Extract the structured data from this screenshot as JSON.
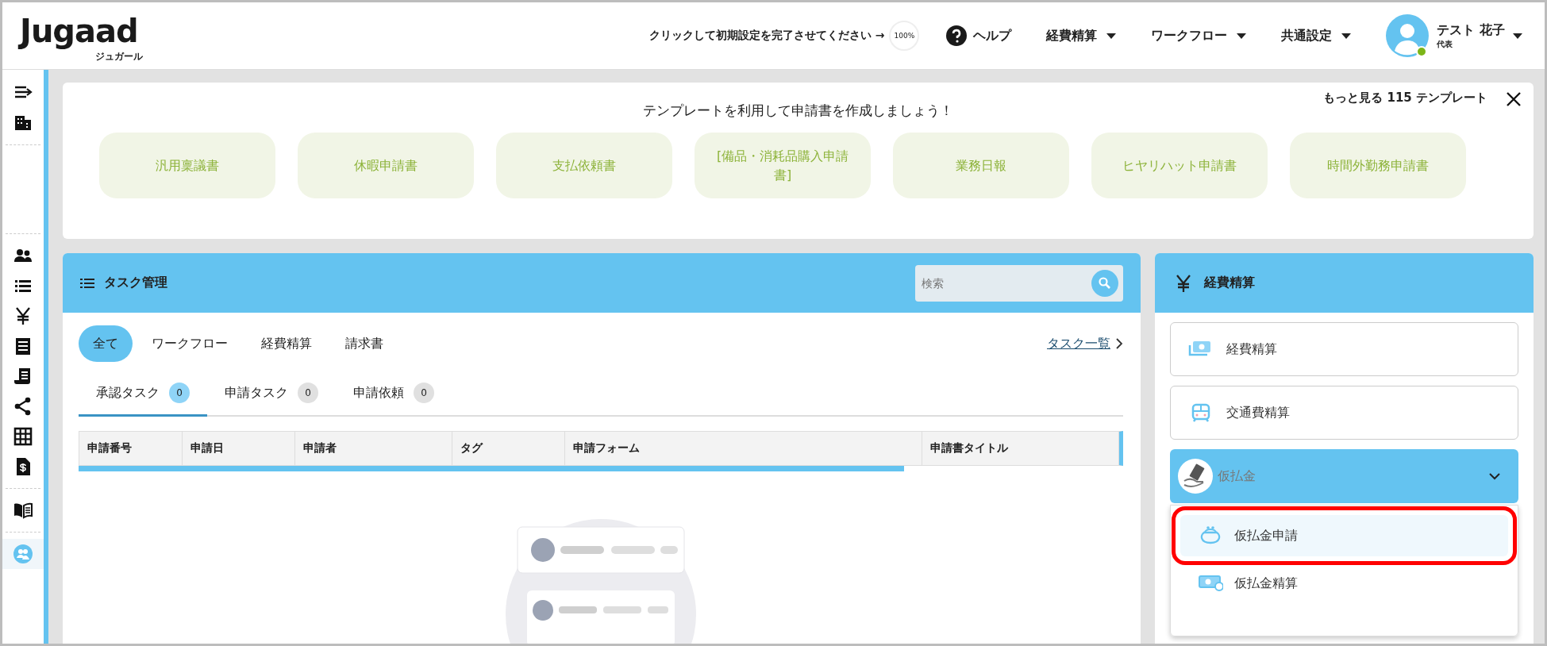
{
  "header": {
    "logo": "Jugaad",
    "logo_sub": "ジュガール",
    "setup_prompt": "クリックして初期設定を完了させてください →",
    "setup_progress": "100%",
    "help": "ヘルプ",
    "menus": [
      {
        "label": "経費精算"
      },
      {
        "label": "ワークフロー"
      },
      {
        "label": "共通設定"
      }
    ],
    "user": {
      "name": "テスト 花子",
      "role": "代表"
    }
  },
  "templates": {
    "heading": "テンプレートを利用して申請書を作成しましょう！",
    "more_link": "もっと見る 115 テンプレート",
    "items": [
      "汎用稟議書",
      "休暇申請書",
      "支払依頼書",
      "[備品・消耗品購入申請書]",
      "業務日報",
      "ヒヤリハット申請書",
      "時間外勤務申請書"
    ]
  },
  "tasks": {
    "title": "タスク管理",
    "search": {
      "placeholder": "検索"
    },
    "filters": [
      {
        "label": "全て",
        "selected": true
      },
      {
        "label": "ワークフロー",
        "selected": false
      },
      {
        "label": "経費精算",
        "selected": false
      },
      {
        "label": "請求書",
        "selected": false
      }
    ],
    "list_link": "タスク一覧",
    "subtabs": [
      {
        "label": "承認タスク",
        "count": "0",
        "selected": true
      },
      {
        "label": "申請タスク",
        "count": "0",
        "selected": false
      },
      {
        "label": "申請依頼",
        "count": "0",
        "selected": false
      }
    ],
    "table": {
      "columns": [
        "申請番号",
        "申請日",
        "申請者",
        "タグ",
        "申請フォーム",
        "申請書タイトル"
      ]
    }
  },
  "expense_panel": {
    "title": "経費精算",
    "items": [
      {
        "label": "経費精算",
        "kind": "bills"
      },
      {
        "label": "交通費精算",
        "kind": "train"
      }
    ],
    "dropdown": {
      "label": "仮払金",
      "expanded": true,
      "options": [
        {
          "label": "仮払金申請",
          "kind": "purse",
          "selected": true,
          "highlighted": true
        },
        {
          "label": "仮払金精算",
          "kind": "cash",
          "selected": false,
          "highlighted": false
        }
      ]
    }
  }
}
